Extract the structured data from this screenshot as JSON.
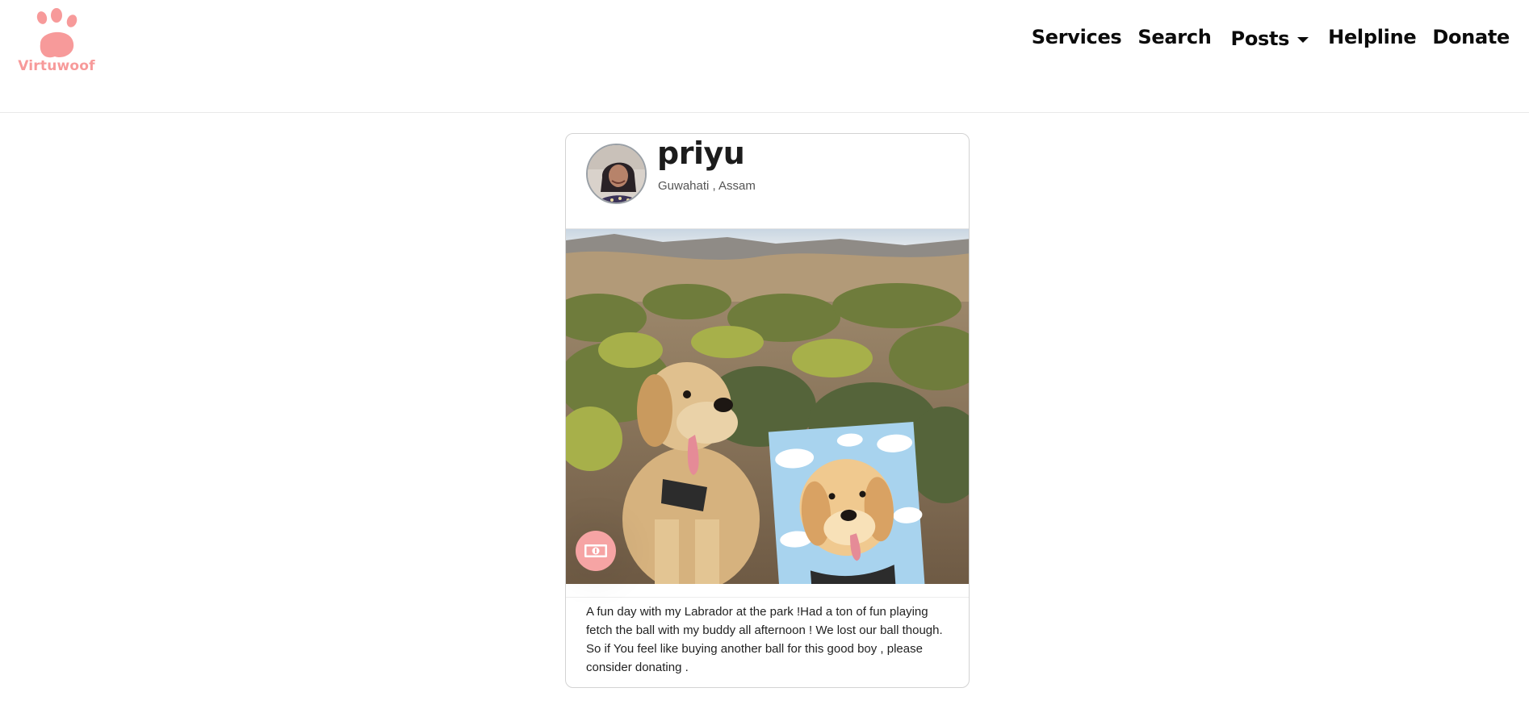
{
  "brand": {
    "name": "Virtuwoof",
    "color": "#f79a9a",
    "icon": "paw-icon"
  },
  "nav": {
    "items": [
      {
        "label": "Services"
      },
      {
        "label": "Search"
      },
      {
        "label": "Posts",
        "has_dropdown": true,
        "icon": "caret-down-icon"
      },
      {
        "label": "Helpline"
      },
      {
        "label": "Donate"
      }
    ]
  },
  "post": {
    "user": {
      "name": "priyu",
      "location": "Guwahati , Assam",
      "avatar": "user-avatar"
    },
    "image": {
      "subject": "dog-photo",
      "description_icon": "golden-retriever-photo"
    },
    "donate_button": {
      "icon": "money-bill-icon",
      "color": "#f6a4a4"
    },
    "caption": "A fun day with my Labrador at the park !Had a ton of fun playing fetch the ball with my buddy all afternoon ! We lost our ball though. So if You feel like buying another ball for this good boy , please consider donating ."
  }
}
